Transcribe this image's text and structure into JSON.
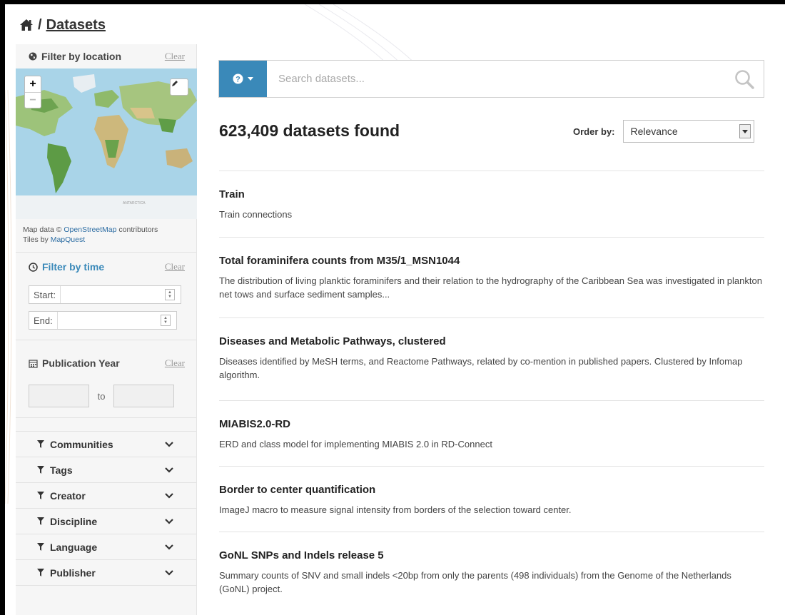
{
  "breadcrumb": {
    "separator": "/",
    "current": "Datasets"
  },
  "sidebar": {
    "location": {
      "title": "Filter by location",
      "clear": "Clear"
    },
    "map": {
      "zoom_in": "+",
      "zoom_out": "−",
      "credit_prefix": "Map data © ",
      "credit_osm": "OpenStreetMap",
      "credit_suffix": " contributors",
      "tiles_prefix": "Tiles by ",
      "tiles_link": "MapQuest",
      "antarctica_label": "ANTARCTICA"
    },
    "time": {
      "title": "Filter by time",
      "clear": "Clear",
      "start_label": "Start:",
      "end_label": "End:"
    },
    "year": {
      "title": "Publication Year",
      "clear": "Clear",
      "to": "to"
    },
    "facets": [
      {
        "label": "Communities"
      },
      {
        "label": "Tags"
      },
      {
        "label": "Creator"
      },
      {
        "label": "Discipline"
      },
      {
        "label": "Language"
      },
      {
        "label": "Publisher"
      }
    ]
  },
  "search": {
    "placeholder": "Search datasets..."
  },
  "summary": {
    "found": "623,409 datasets found",
    "order_label": "Order by:",
    "order_value": "Relevance"
  },
  "results": [
    {
      "title": "Train",
      "description": "Train connections"
    },
    {
      "title": "Total foraminifera counts from M35/1_MSN1044",
      "description": "The distribution of living planktic foraminifers and their relation to the hydrography of the Caribbean Sea was investigated in plankton net tows and surface sediment samples..."
    },
    {
      "title": "Diseases and Metabolic Pathways, clustered",
      "description": "Diseases identified by MeSH terms, and Reactome Pathways, related by co-mention in published papers. Clustered by Infomap algorithm."
    },
    {
      "title": "MIABIS2.0-RD",
      "description": "ERD and class model for implementing MIABIS 2.0 in RD-Connect"
    },
    {
      "title": "Border to center quantification",
      "description": "ImageJ macro to measure signal intensity from borders of the selection toward center."
    },
    {
      "title": "GoNL SNPs and Indels release 5",
      "description": "Summary counts of SNV and small indels <20bp from only the parents (498 individuals) from the Genome of the Netherlands (GoNL) project."
    }
  ],
  "colors": {
    "accent": "#3a89b9",
    "sidebar_bg": "#f6f6f6"
  }
}
